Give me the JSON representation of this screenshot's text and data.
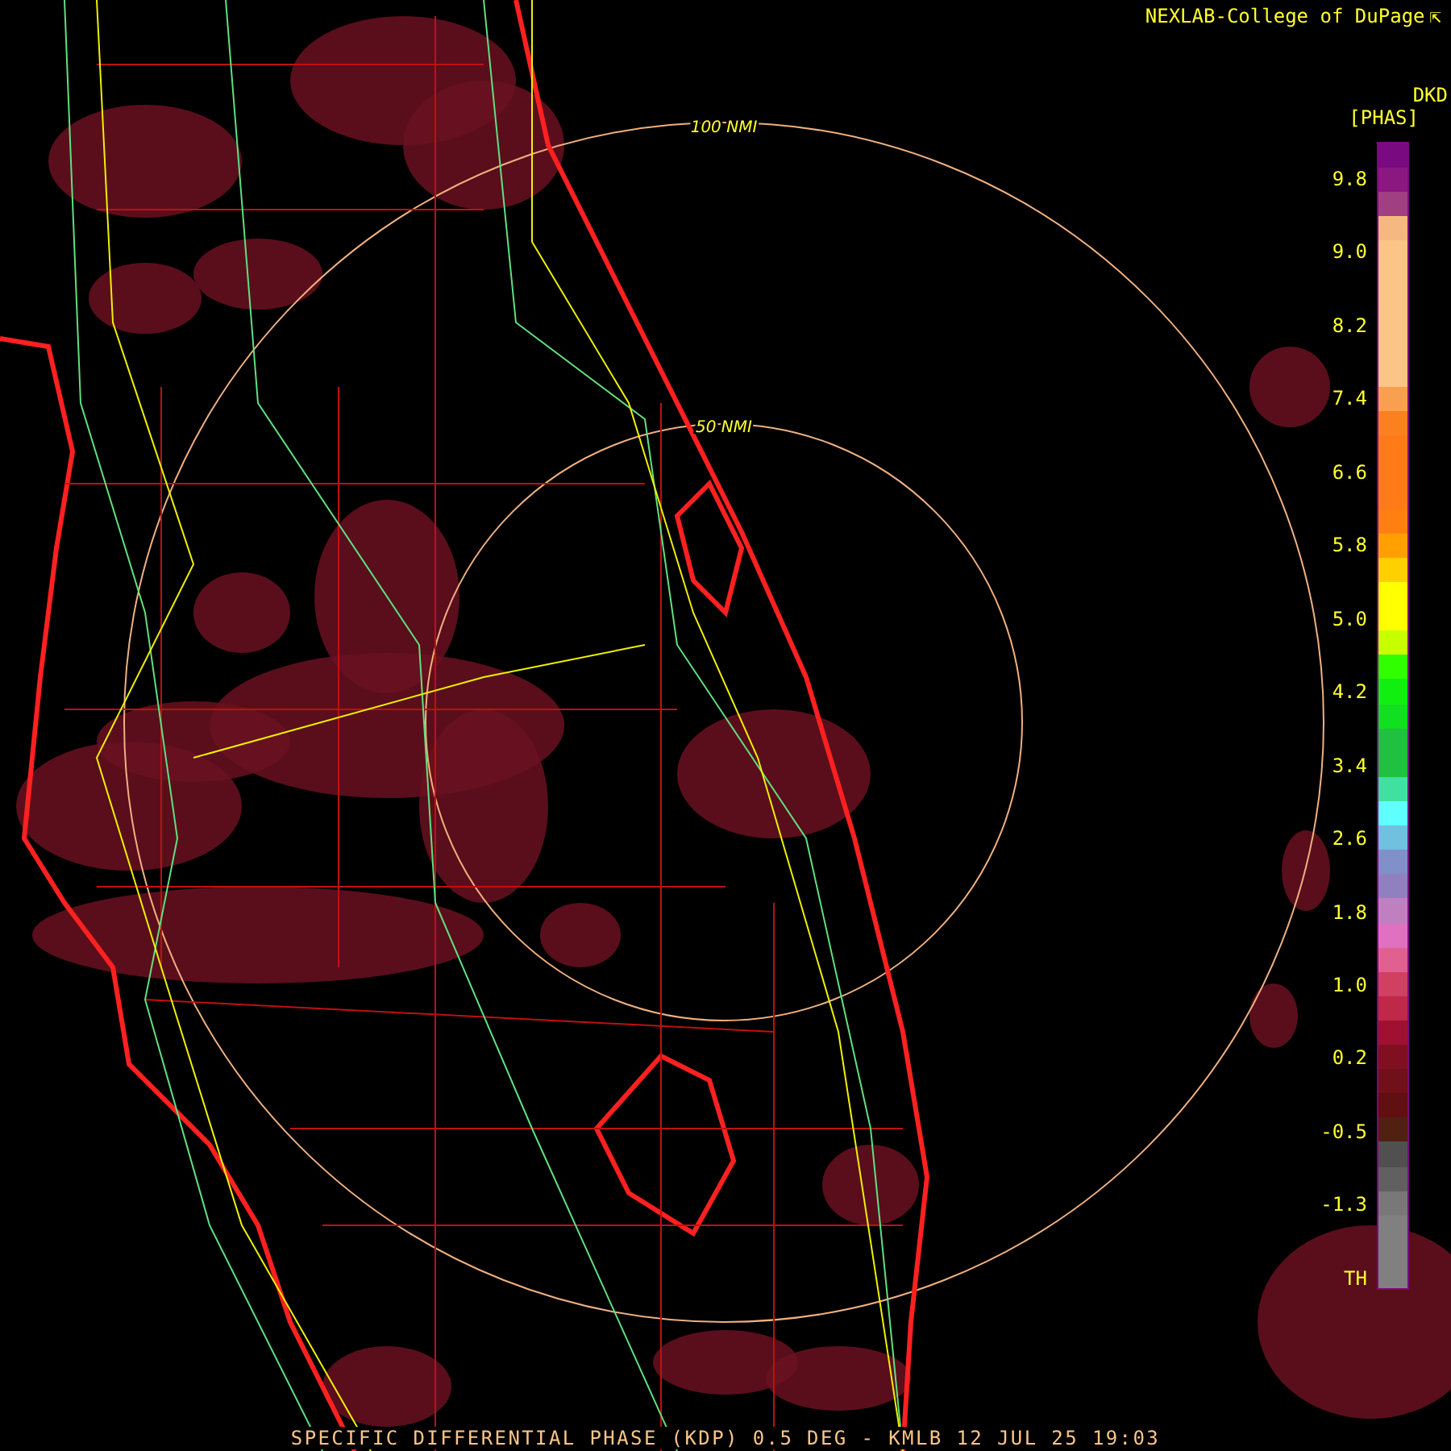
{
  "credit": "NEXLAB-College of DuPage",
  "credit_icon_text": "⇱",
  "legend": {
    "unit": "DKD",
    "name": "[PHAS]",
    "segments": [
      {
        "color": "#7a0a80"
      },
      {
        "color": "#8a1880"
      },
      {
        "color": "#a04080"
      },
      {
        "color": "#f5b880"
      },
      {
        "color": "#fbc588"
      },
      {
        "color": "#fbc588"
      },
      {
        "color": "#fbc588"
      },
      {
        "color": "#fbc588"
      },
      {
        "color": "#fbc588"
      },
      {
        "color": "#fbc588"
      },
      {
        "color": "#f8a050"
      },
      {
        "color": "#fa8020"
      },
      {
        "color": "#ff7a18"
      },
      {
        "color": "#ff7a18"
      },
      {
        "color": "#ff7a18"
      },
      {
        "color": "#ff8010"
      },
      {
        "color": "#ffa000"
      },
      {
        "color": "#ffd000"
      },
      {
        "color": "#ffff00"
      },
      {
        "color": "#ffff00"
      },
      {
        "color": "#c8ff00"
      },
      {
        "color": "#30ff00"
      },
      {
        "color": "#10f010"
      },
      {
        "color": "#10e020"
      },
      {
        "color": "#20c040"
      },
      {
        "color": "#20c040"
      },
      {
        "color": "#40e0a0"
      },
      {
        "color": "#60ffff"
      },
      {
        "color": "#70c0e0"
      },
      {
        "color": "#8090c8"
      },
      {
        "color": "#9080c0"
      },
      {
        "color": "#c080c0"
      },
      {
        "color": "#e070c0"
      },
      {
        "color": "#e06090"
      },
      {
        "color": "#d04060"
      },
      {
        "color": "#c02848"
      },
      {
        "color": "#a01030"
      },
      {
        "color": "#801020"
      },
      {
        "color": "#701018"
      },
      {
        "color": "#601010"
      },
      {
        "color": "#502010"
      },
      {
        "color": "#505050"
      },
      {
        "color": "#606060"
      },
      {
        "color": "#787878"
      },
      {
        "color": "#808080"
      },
      {
        "color": "#808080"
      },
      {
        "color": "#808080"
      }
    ],
    "labels": [
      "9.8",
      "9.0",
      "8.2",
      "7.4",
      "6.6",
      "5.8",
      "5.0",
      "4.2",
      "3.4",
      "2.6",
      "1.8",
      "1.0",
      "0.2",
      "-0.5",
      "-1.3",
      "TH"
    ]
  },
  "rings": [
    "100 NMI",
    "50 NMI"
  ],
  "caption": "SPECIFIC DIFFERENTIAL PHASE (KDP) 0.5 DEG - KMLB 12 JUL 25 19:03"
}
